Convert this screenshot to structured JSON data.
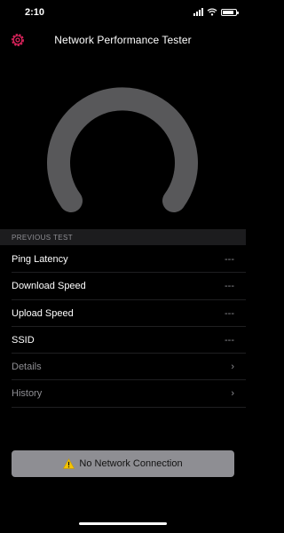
{
  "status_bar": {
    "time": "2:10"
  },
  "nav": {
    "title": "Network Performance Tester",
    "settings_icon": "gear-icon"
  },
  "colors": {
    "accent": "#e0245e",
    "gauge": "#58585a",
    "background": "#000000",
    "button": "#8e8e93"
  },
  "section_header": "PREVIOUS TEST",
  "results": [
    {
      "label": "Ping Latency",
      "value": "---"
    },
    {
      "label": "Download Speed",
      "value": "---"
    },
    {
      "label": "Upload Speed",
      "value": "---"
    },
    {
      "label": "SSID",
      "value": "---"
    }
  ],
  "links": [
    {
      "label": "Details"
    },
    {
      "label": "History"
    }
  ],
  "connection_button": {
    "label": "No Network Connection",
    "icon": "warning-icon"
  }
}
